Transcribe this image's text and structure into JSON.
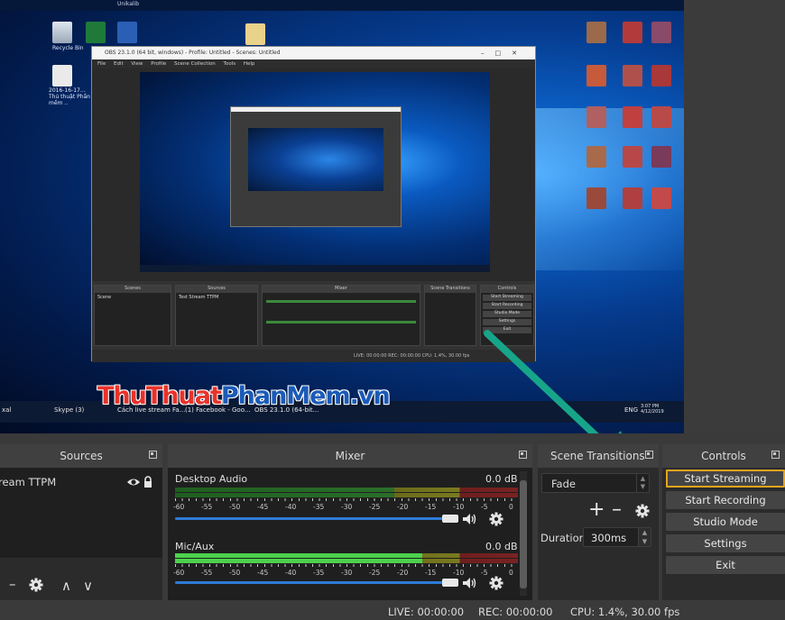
{
  "preview": {
    "desktop_top_text": "Unikalib",
    "desktop_icons": [
      {
        "label": "Recycle Bin",
        "icon": "recycle-bin-icon"
      },
      {
        "label": "",
        "icon": "excel-file-icon"
      },
      {
        "label": "",
        "icon": "word-file-icon"
      },
      {
        "label": "2016-16-17… Thủ thuật Phần mềm ..",
        "icon": "word-file-icon"
      }
    ],
    "inner_window": {
      "title": "OBS 23.1.0 (64 bit, windows) - Profile: Untitled - Scenes: Untitled",
      "menu": [
        "File",
        "Edit",
        "View",
        "Profile",
        "Scene Collection",
        "Tools",
        "Help"
      ],
      "panels": [
        "Scenes",
        "Sources",
        "Mixer",
        "Scene Transitions",
        "Controls"
      ],
      "scene_item": "Scene",
      "source_item": "Test Stream TTPM",
      "controls": [
        "Start Streaming",
        "Start Recording",
        "Studio Mode",
        "Settings",
        "Exit"
      ],
      "status": "LIVE: 00:00:00     REC: 00:00:00     CPU: 1.4%, 30.00 fps"
    },
    "taskbar": {
      "left_label": "xal",
      "items": [
        "Skype (3)",
        "Cách live stream Fa...",
        "(1) Facebook - Goo...",
        "OBS 23.1.0 (64-bit..."
      ],
      "lang": "ENG",
      "clock": "3:07 PM 4/12/2019"
    },
    "watermark": {
      "part1": "ThuThuat",
      "part2": "PhanMem",
      "part3": ".vn"
    }
  },
  "sources": {
    "title": "Sources",
    "items": [
      {
        "name": "ream TTPM",
        "visible": true,
        "locked": true
      }
    ],
    "tools": {
      "add": "+",
      "remove": "–",
      "up": "∧",
      "down": "∨"
    }
  },
  "mixer": {
    "title": "Mixer",
    "ticks": [
      "-60",
      "-55",
      "-50",
      "-45",
      "-40",
      "-35",
      "-30",
      "-25",
      "-20",
      "-15",
      "-10",
      "-5",
      "0"
    ],
    "tracks": [
      {
        "name": "Desktop Audio",
        "db": "0.0 dB",
        "level": 0.0,
        "volume": 1.0
      },
      {
        "name": "Mic/Aux",
        "db": "0.0 dB",
        "level": 0.72,
        "volume": 1.0
      }
    ]
  },
  "transitions": {
    "title": "Scene Transitions",
    "selected": "Fade",
    "add": "+",
    "remove": "–",
    "duration_label": "Duration",
    "duration_value": "300ms"
  },
  "controls": {
    "title": "Controls",
    "buttons": [
      "Start Streaming",
      "Start Recording",
      "Studio Mode",
      "Settings",
      "Exit"
    ],
    "focused": "Start Streaming"
  },
  "status": {
    "live": "LIVE: 00:00:00",
    "rec": "REC: 00:00:00",
    "cpu": "CPU: 1.4%, 30.00 fps"
  },
  "colors": {
    "focus_outline": "#e6a41e",
    "arrow": "#17a589",
    "meter_green": "#4cd24c",
    "slider_blue": "#2e7bd8"
  }
}
